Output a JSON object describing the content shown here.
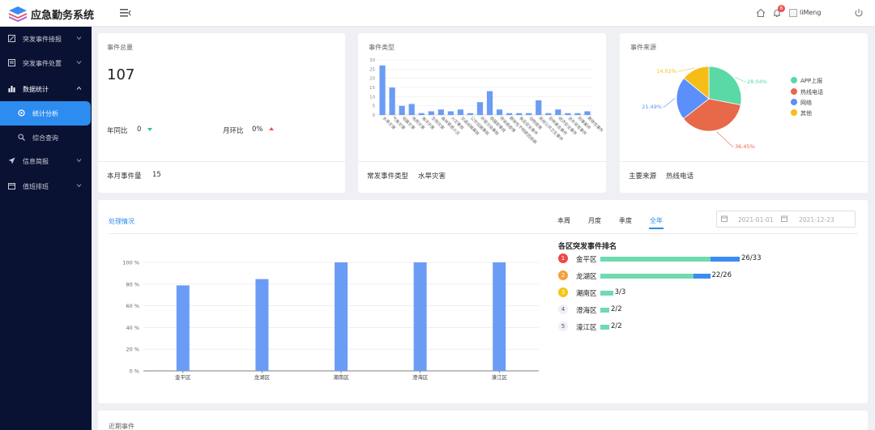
{
  "header": {
    "app_title": "应急勤务系统",
    "notification_count": "6",
    "username": "liMeng"
  },
  "sidebar": {
    "items": [
      {
        "label": "突发事件接报",
        "expandable": true
      },
      {
        "label": "突发事件处置",
        "expandable": true
      },
      {
        "label": "数据统计",
        "expandable": true,
        "expanded": true
      },
      {
        "label": "统计分析",
        "active": true
      },
      {
        "label": "综合查询"
      },
      {
        "label": "信息简报",
        "expandable": true
      },
      {
        "label": "值班排班",
        "expandable": true
      }
    ]
  },
  "cards": {
    "total": {
      "title": "事件总量",
      "value": "107",
      "yoy_label": "年同比",
      "yoy_value": "0",
      "mom_label": "月环比",
      "mom_value": "0%",
      "month_label": "本月事件量",
      "month_value": "15"
    },
    "types": {
      "title": "事件类型",
      "footer_label": "常发事件类型",
      "footer_value": "水旱灾害"
    },
    "sources": {
      "title": "事件来源",
      "footer_label": "主要来源",
      "footer_value": "热线电话"
    }
  },
  "processing": {
    "title": "处理情况",
    "tabs": [
      "本周",
      "月度",
      "季度",
      "全年"
    ],
    "active_tab": "全年",
    "date_start": "2021-01-01",
    "date_end": "2021-12-23",
    "ranking_title": "各区突发事件排名",
    "ranking": [
      {
        "rank": "1",
        "name": "金平区",
        "value": "26/33",
        "done": 26,
        "total": 33,
        "color": "#f04747"
      },
      {
        "rank": "2",
        "name": "龙湖区",
        "value": "22/26",
        "done": 22,
        "total": 26,
        "color": "#f5a03b"
      },
      {
        "rank": "3",
        "name": "潮南区",
        "value": "3/3",
        "done": 3,
        "total": 3,
        "color": "#f5c518"
      },
      {
        "rank": "4",
        "name": "澄海区",
        "value": "2/2",
        "done": 2,
        "total": 2,
        "color": ""
      },
      {
        "rank": "5",
        "name": "濠江区",
        "value": "2/2",
        "done": 2,
        "total": 2,
        "color": ""
      }
    ]
  },
  "recent": {
    "title": "近期事件"
  },
  "colors": {
    "accent": "#2d8cf0",
    "sidebar_bg": "#0a1233",
    "bar": "#6b9cf5",
    "rank_green": "#6fd9b0",
    "rank_blue": "#3b8bf5"
  },
  "chart_data": [
    {
      "type": "bar",
      "title": "事件类型",
      "ylim": [
        0,
        30
      ],
      "y_ticks": [
        "0",
        "5",
        "10",
        "15",
        "20",
        "25",
        "30"
      ],
      "categories": [
        "水旱灾害",
        "气象灾害",
        "地震灾害",
        "地质灾害",
        "海洋灾害",
        "生物灾害",
        "森林草原火灾",
        "火灾事故",
        "交通运输事故",
        "公共设施事故",
        "环境污染事故",
        "核辐射事故",
        "传染病疫情",
        "群体性不明原因疾病",
        "食品安全事件",
        "动物疫情",
        "其他公共卫生事件",
        "恐怖袭击事件",
        "经济安全事件",
        "涉外突发事件",
        "刑事案件",
        "群体性事件",
        "民族宗教事件",
        "网络信息安全事件",
        "其他社会安全事件",
        "其他突发事件"
      ],
      "values": [
        27,
        15,
        5,
        6,
        1,
        2,
        3,
        2,
        3,
        1,
        7,
        13,
        3,
        1,
        1,
        1,
        8,
        1,
        3,
        1,
        1,
        2
      ]
    },
    {
      "type": "pie",
      "title": "事件来源",
      "labels": [
        "APP上报",
        "热线电话",
        "网络",
        "其他"
      ],
      "values": [
        28.04,
        36.45,
        21.49,
        14.02
      ],
      "value_labels": [
        "28.04%",
        "36.45%",
        "21.49%",
        "14.02%"
      ],
      "colors": [
        "#5ad8a6",
        "#e8684a",
        "#5b8ff9",
        "#f6bd16"
      ]
    },
    {
      "type": "bar",
      "title": "处理情况",
      "categories": [
        "金平区",
        "龙湖区",
        "潮南区",
        "澄海区",
        "濠江区"
      ],
      "values": [
        78.8,
        84.6,
        100,
        100,
        100
      ],
      "ylim": [
        0,
        100
      ],
      "y_ticks": [
        "0 %",
        "20 %",
        "40 %",
        "60 %",
        "80 %",
        "100 %"
      ]
    }
  ]
}
